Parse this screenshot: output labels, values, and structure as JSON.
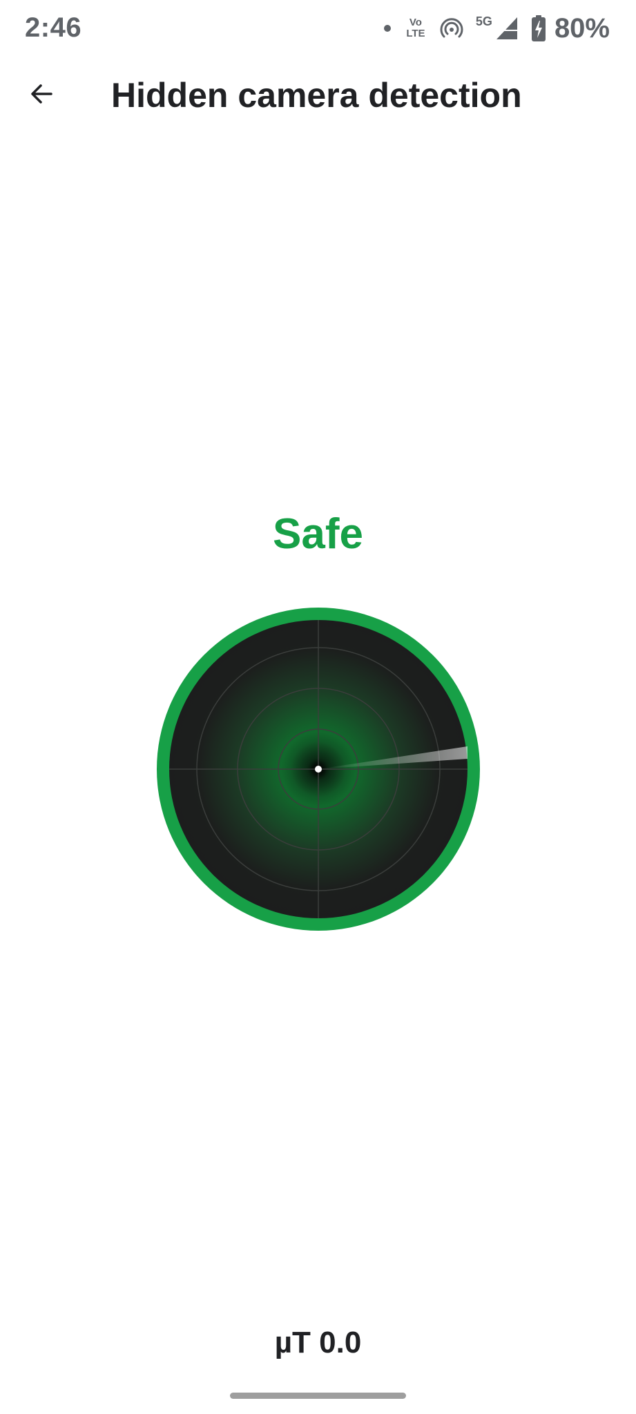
{
  "status_bar": {
    "time": "2:46",
    "network_type": "5G",
    "volte_top": "Vo",
    "volte_bottom": "LTE",
    "battery_percent": "80%",
    "icons": [
      "dot-icon",
      "volte-icon",
      "hotspot-icon",
      "signal-icon",
      "battery-charging-icon"
    ]
  },
  "app_bar": {
    "back_icon": "arrow-left-icon",
    "title": "Hidden camera detection"
  },
  "detector": {
    "status": "Safe",
    "status_color": "#17a047",
    "ring_color": "#17a047",
    "radar_background": "#1c1d1d",
    "reading": "µT 0.0"
  }
}
